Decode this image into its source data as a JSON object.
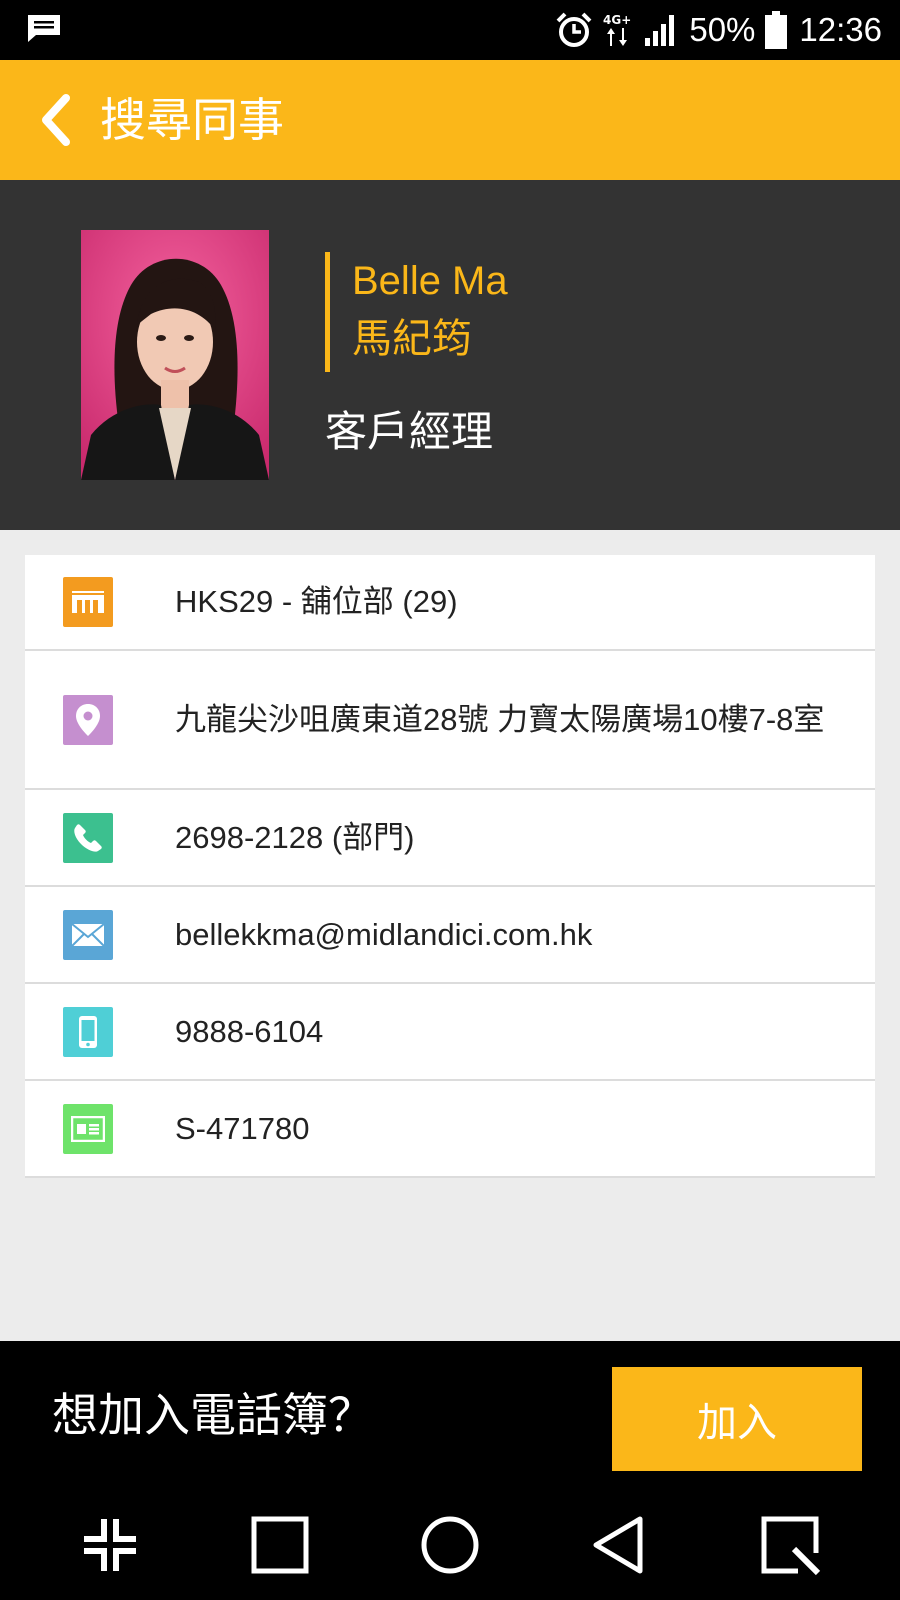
{
  "status_bar": {
    "battery_percent": "50%",
    "time": "12:36",
    "network": "4G+",
    "icons": [
      "message-icon",
      "alarm-icon",
      "network-4g-icon",
      "signal-icon",
      "battery-icon"
    ]
  },
  "app_bar": {
    "title": "搜尋同事",
    "back_icon": "chevron-left-icon"
  },
  "profile": {
    "name_en": "Belle Ma",
    "name_zh": "馬紀筠",
    "position": "客戶經理"
  },
  "info_rows": [
    {
      "icon": "company-logo-icon",
      "color": "#f39b1f",
      "text": "HKS29 - 舖位部 (29)"
    },
    {
      "icon": "location-pin-icon",
      "color": "#c58fcf",
      "text": "九龍尖沙咀廣東道28號 力寶太陽廣場10樓7-8室"
    },
    {
      "icon": "phone-icon",
      "color": "#3cc08f",
      "text": "2698-2128 (部門)"
    },
    {
      "icon": "mail-icon",
      "color": "#5aa6d6",
      "text": "bellekkma@midlandici.com.hk"
    },
    {
      "icon": "mobile-phone-icon",
      "color": "#4fcfd6",
      "text": "9888-6104"
    },
    {
      "icon": "id-card-icon",
      "color": "#6ee36a",
      "text": "S-471780"
    }
  ],
  "bottom_bar": {
    "prompt": "想加入電話簿？",
    "join_label": "加入"
  },
  "nav_bar": {
    "items": [
      "collapse-icon",
      "recents-square-icon",
      "home-circle-icon",
      "back-triangle-icon",
      "screenshot-icon"
    ]
  },
  "colors": {
    "accent": "#fbb719",
    "profile_bg": "#333333",
    "page_bg": "#ececec"
  }
}
